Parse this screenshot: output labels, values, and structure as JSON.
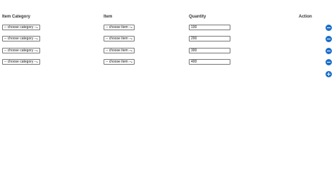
{
  "headers": {
    "item_category": "Item Category",
    "item": "Item",
    "quantity": "Quantity",
    "action": "Action"
  },
  "rows": [
    {
      "category": "-- choose category --",
      "item": "-- choose item --",
      "quantity": "100",
      "action_icon": "remove-icon"
    },
    {
      "category": "-- choose category --",
      "item": "-- choose item --",
      "quantity": "200",
      "action_icon": "remove-icon"
    },
    {
      "category": "-- choose category --",
      "item": "-- choose item --",
      "quantity": "300",
      "action_icon": "remove-icon"
    },
    {
      "category": "-- choose category --",
      "item": "-- choose item --",
      "quantity": "400",
      "action_icon": "remove-icon"
    }
  ],
  "add_row": {
    "icon": "add-icon"
  },
  "colors": {
    "action_button": "#1a6fc8"
  }
}
